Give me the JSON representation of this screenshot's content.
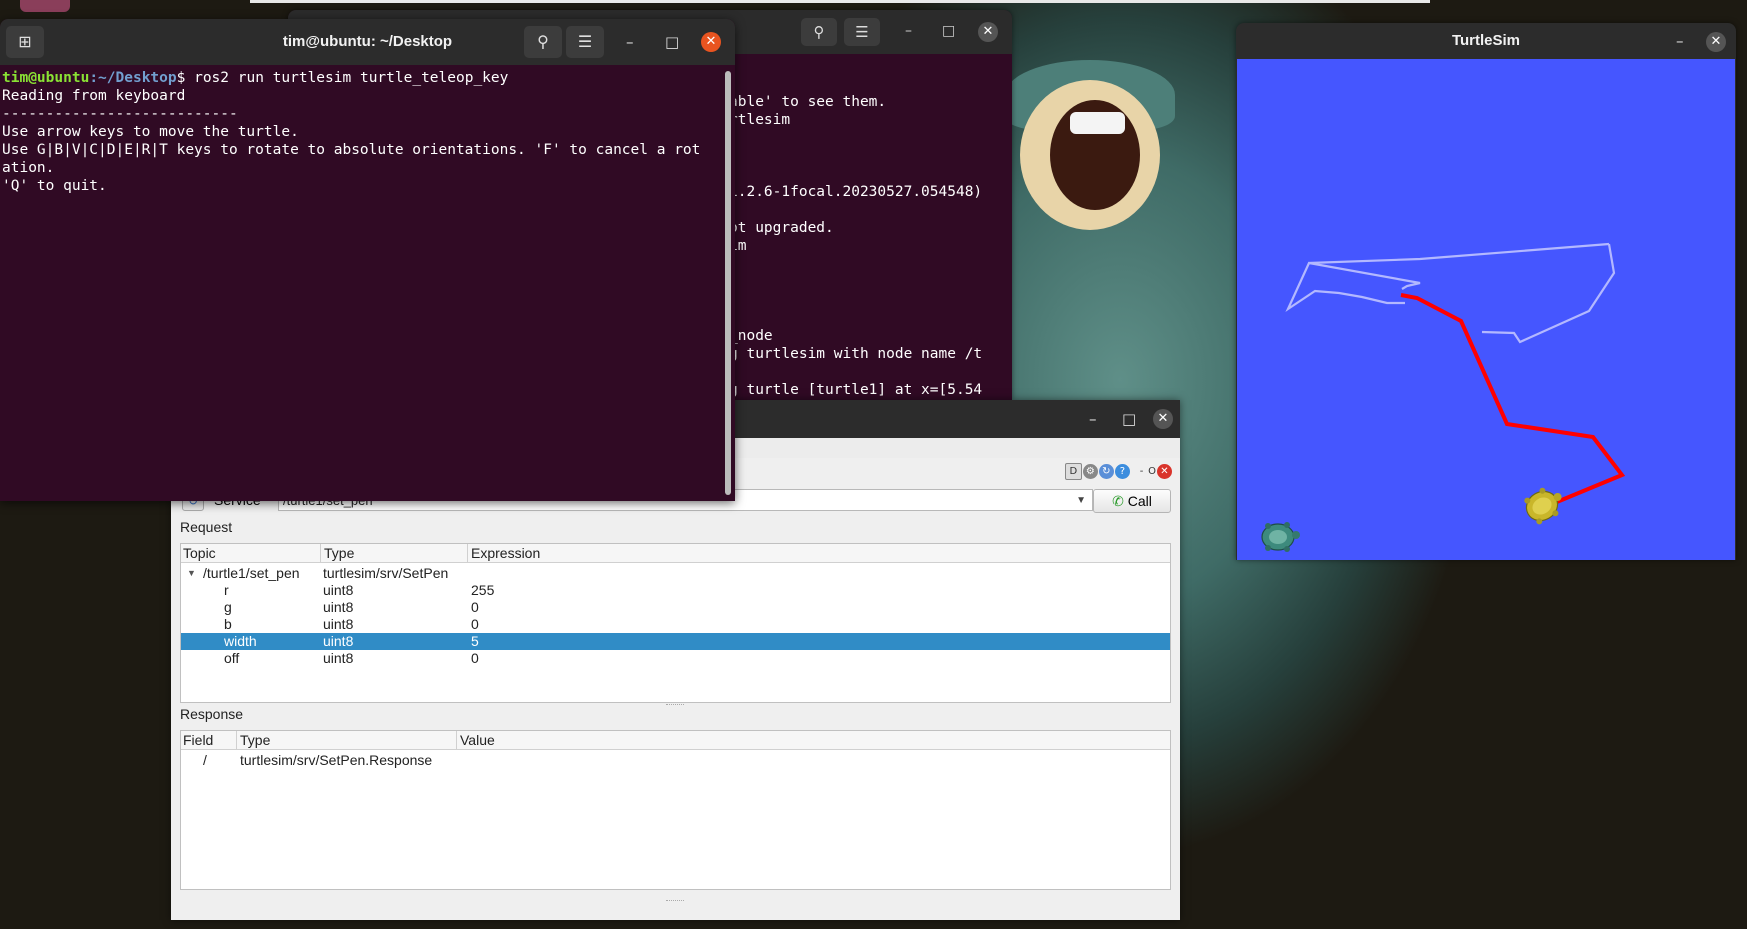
{
  "back_terminal": {
    "lines": [
      "able' to see them.",
      "rtlesim",
      "1.2.6-1focal.20230527.054548)",
      "ot upgraded.",
      "im",
      "_node",
      "g turtlesim with node name /t",
      "g turtle [turtle1] at x=[5.54"
    ]
  },
  "front_terminal": {
    "title": "tim@ubuntu: ~/Desktop",
    "prompt_user": "tim@ubuntu",
    "prompt_path": ":~/Desktop",
    "prompt_symbol": "$ ",
    "command": "ros2 run turtlesim turtle_teleop_key",
    "output": [
      "Reading from keyboard",
      "---------------------------",
      "Use arrow keys to move the turtle.",
      "Use G|B|V|C|D|E|R|T keys to rotate to absolute orientations. 'F' to cancel a rot",
      "ation.",
      "'Q' to quit."
    ]
  },
  "rqt": {
    "plugin_label_d": "D",
    "plugin_label_o": "O",
    "service_label": "Service",
    "service_value": "/turtle1/set_pen",
    "call_label": "Call",
    "request_label": "Request",
    "request_headers": [
      "Topic",
      "Type",
      "Expression"
    ],
    "request_rows": [
      {
        "topic": "/turtle1/set_pen",
        "type": "turtlesim/srv/SetPen",
        "expr": ""
      },
      {
        "topic": "r",
        "type": "uint8",
        "expr": "255"
      },
      {
        "topic": "g",
        "type": "uint8",
        "expr": "0"
      },
      {
        "topic": "b",
        "type": "uint8",
        "expr": "0"
      },
      {
        "topic": "width",
        "type": "uint8",
        "expr": "5"
      },
      {
        "topic": "off",
        "type": "uint8",
        "expr": "0"
      }
    ],
    "response_label": "Response",
    "response_headers": [
      "Field",
      "Type",
      "Value"
    ],
    "response_rows": [
      {
        "field": "/",
        "type": "turtlesim/srv/SetPen.Response",
        "value": ""
      }
    ]
  },
  "turtlesim": {
    "title": "TurtleSim",
    "background_color": "#4556ff",
    "trail_color_1": "#b3b8ff",
    "trail_color_2": "#ff0000"
  }
}
